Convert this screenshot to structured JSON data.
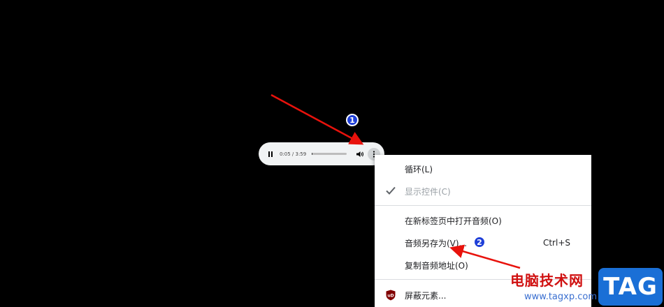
{
  "player": {
    "time": "0:05 / 3:59",
    "progress": 0.02,
    "volume": 1.0
  },
  "context_menu": {
    "items": [
      {
        "label": "循环(L)",
        "shortcut": "",
        "enabled": true,
        "checked": false,
        "icon": ""
      },
      {
        "label": "显示控件(C)",
        "shortcut": "",
        "enabled": false,
        "checked": true,
        "icon": "check-icon"
      },
      {
        "label": "在新标签页中打开音频(O)",
        "shortcut": "",
        "enabled": true,
        "checked": false,
        "icon": ""
      },
      {
        "label": "音频另存为(V)...",
        "shortcut": "Ctrl+S",
        "enabled": true,
        "checked": false,
        "icon": ""
      },
      {
        "label": "复制音频地址(O)",
        "shortcut": "",
        "enabled": true,
        "checked": false,
        "icon": ""
      },
      {
        "label": "屏蔽元素...",
        "shortcut": "",
        "enabled": true,
        "checked": false,
        "icon": "ublock-icon"
      }
    ]
  },
  "annotations": {
    "badge_1": "1",
    "badge_2": "2",
    "arrow_color": "#e8120c",
    "badge_color": "#1f3fd8"
  },
  "watermark": {
    "text": "电脑技术网",
    "url": "www.tagxp.com",
    "tag": "TAG"
  }
}
